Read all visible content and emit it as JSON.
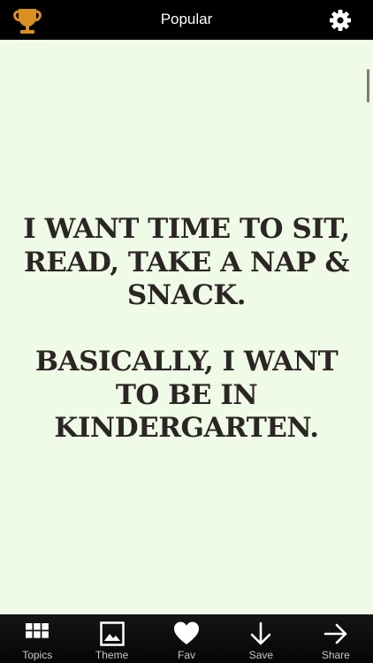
{
  "header": {
    "title": "Popular",
    "left_icon": "trophy-icon",
    "right_icon": "gear-icon"
  },
  "quote": {
    "paragraphs": [
      "I WANT TIME TO SIT, READ, TAKE A NAP & SNACK.",
      "BASICALLY, I WANT TO BE IN KINDERGARTEN."
    ]
  },
  "tabs": [
    {
      "label": "Topics",
      "icon": "grid-icon"
    },
    {
      "label": "Theme",
      "icon": "image-icon"
    },
    {
      "label": "Fav",
      "icon": "heart-icon"
    },
    {
      "label": "Save",
      "icon": "download-arrow-icon"
    },
    {
      "label": "Share",
      "icon": "share-arrow-icon"
    }
  ],
  "colors": {
    "background": "#effbe6",
    "text": "#2b2624",
    "bar": "#000000",
    "trophy": "#d9911f"
  }
}
